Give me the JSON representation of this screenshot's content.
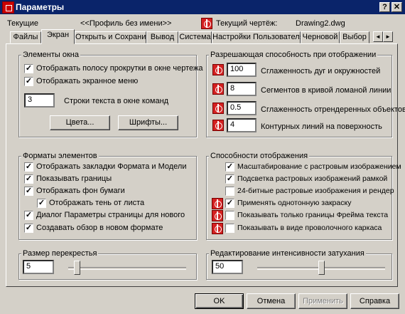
{
  "window": {
    "title": "Параметры",
    "help_glyph": "?",
    "close_glyph": "✕"
  },
  "header": {
    "current_label": "Текущие",
    "profile": "<<Профиль без имени>>",
    "drawing_label": "Текущий чертёж:",
    "drawing_name": "Drawing2.dwg"
  },
  "tabs": [
    "Файлы",
    "Экран",
    "Открыть и Сохранить",
    "Вывод",
    "Система",
    "Настройки Пользователя",
    "Черновой",
    "Выбор"
  ],
  "tab_scroll": {
    "left": "◄",
    "right": "►"
  },
  "window_elements": {
    "label": "Элементы окна",
    "items": [
      {
        "label": "Отображать полосу прокрутки в окне чертежа",
        "checked": "✓"
      },
      {
        "label": "Отображать экранное меню",
        "checked": "✓"
      }
    ],
    "command_lines_value": "3",
    "command_lines_label": "Строки текста в окне команд",
    "colors_button": "Цвета...",
    "fonts_button": "Шрифты..."
  },
  "resolution": {
    "label": "Разрешающая способность при отображении",
    "items": [
      {
        "value": "100",
        "label": "Сглаженность дуг и окружностей"
      },
      {
        "value": "8",
        "label": "Сегментов в кривой ломаной линии"
      },
      {
        "value": "0.5",
        "label": "Сглаженность отрендеренных объектов"
      },
      {
        "value": "4",
        "label": "Контурных линий на поверхность"
      }
    ]
  },
  "layout_elements": {
    "label": "Форматы элементов",
    "items": [
      {
        "label": "Отображать закладки Формата и Модели",
        "checked": "✓"
      },
      {
        "label": "Показывать границы",
        "checked": "✓"
      },
      {
        "label": "Отображать фон бумаги",
        "checked": "✓"
      },
      {
        "label": "Отображать тень от листа",
        "checked": "✓"
      },
      {
        "label": "Диалог Параметры страницы для нового",
        "checked": "✓"
      },
      {
        "label": "Создавать обзор в новом формате",
        "checked": "✓"
      }
    ]
  },
  "display_performance": {
    "label": "Способности отображения",
    "items": [
      {
        "label": "Масштабирование с растровым изображением",
        "checked": "✓"
      },
      {
        "label": "Подсветка растровых изображений рамкой",
        "checked": "✓"
      },
      {
        "label": "24-битные растровые изображения и рендер",
        "checked": ""
      },
      {
        "label": "Применять однотонную закраску",
        "checked": "✓"
      },
      {
        "label": "Показывать только границы Фрейма текста",
        "checked": ""
      },
      {
        "label": "Показывать в виде проволочного каркаса",
        "checked": ""
      }
    ]
  },
  "crosshair": {
    "label": "Размер перекрестья",
    "value": "5",
    "slider_fraction": 0.05
  },
  "fade": {
    "label": "Редактирование интенсивности затухания",
    "value": "50",
    "slider_fraction": 0.5
  },
  "buttons": {
    "ok": "OK",
    "cancel": "Отмена",
    "apply": "Применить",
    "help": "Справка"
  },
  "colors": {
    "titlebar": "#0a246a",
    "face": "#d4d0c8",
    "icon_red": "#d42020"
  }
}
